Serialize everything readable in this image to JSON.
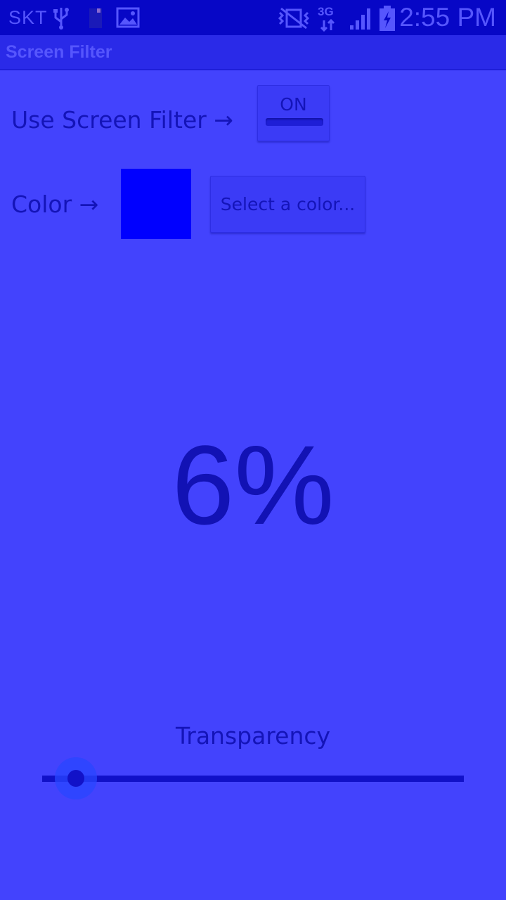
{
  "status_bar": {
    "carrier": "SKT",
    "network": "3G",
    "time": "2:55 PM",
    "icons": [
      "usb-icon",
      "sim-icon",
      "image-icon",
      "no-sim-vibrate-icon",
      "data-arrows-icon",
      "signal-icon",
      "battery-charging-icon"
    ]
  },
  "action_bar": {
    "title": "Screen Filter"
  },
  "filter_row": {
    "label": "Use Screen Filter →",
    "toggle_label": "ON"
  },
  "color_row": {
    "label": "Color →",
    "swatch_color": "#0000ff",
    "select_button_label": "Select a color..."
  },
  "percent_display": "6%",
  "transparency": {
    "label": "Transparency",
    "value_percent": 8
  },
  "colors": {
    "background": "#4343fd",
    "status_bar": "#0707c6",
    "action_bar": "#2a2ae8",
    "text": "#1414b8"
  }
}
